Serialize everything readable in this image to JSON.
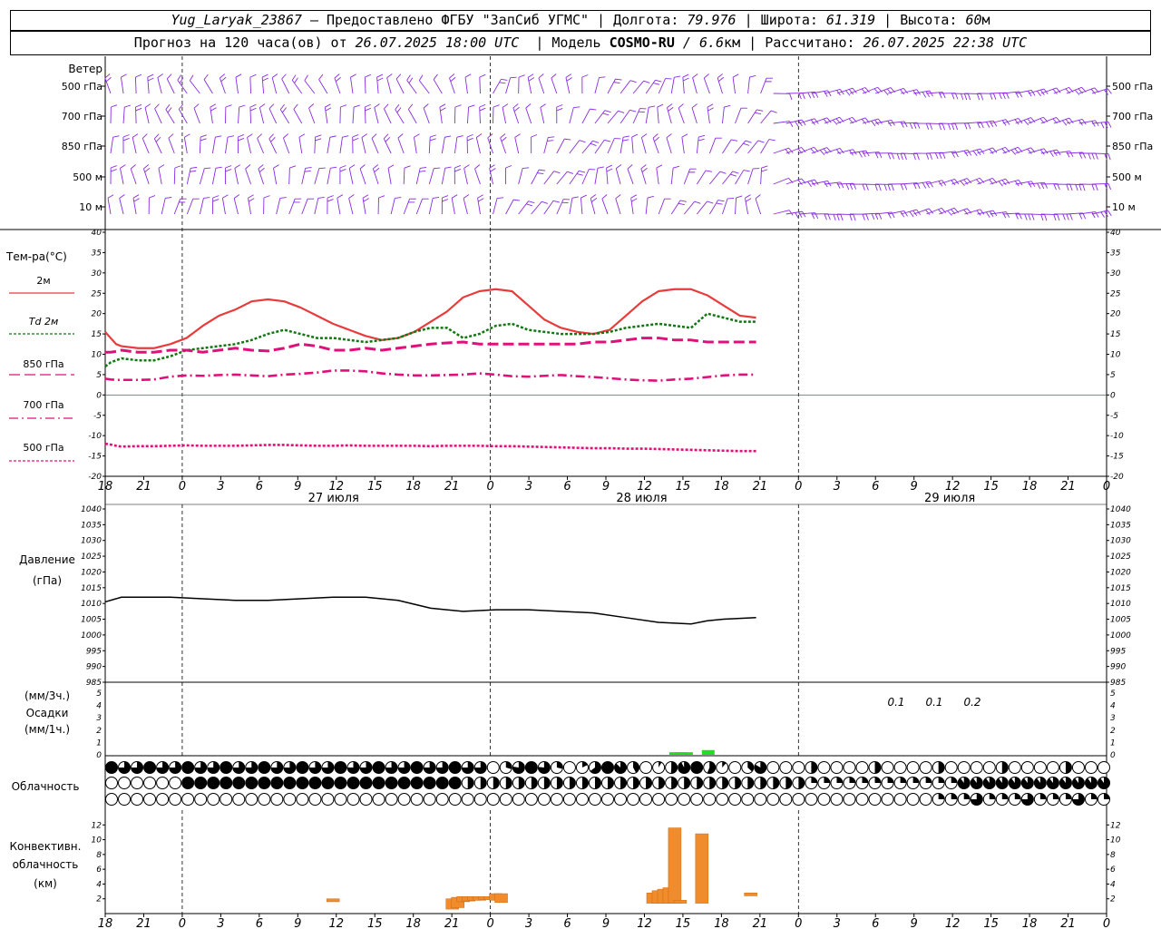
{
  "header": {
    "station": "Yug_Laryak_23867",
    "provided": "— Предоставлено ФГБУ \"ЗапСиб УГМС\"",
    "lon_label": "Долгота:",
    "lon": "79.976",
    "lat_label": "Широта:",
    "lat": "61.319",
    "alt_label": "Высота:",
    "alt": "60",
    "alt_unit": "м",
    "forecast_label": "Прогноз на 120 часа(ов) от",
    "forecast_from": "26.07.2025 18:00 UTC",
    "model_label": "Модель",
    "model": "COSMO-RU",
    "model_res": "/ 6.6",
    "model_res_unit": "км",
    "computed_label": "Рассчитано:",
    "computed": "26.07.2025 22:38 UTC"
  },
  "time_axis": {
    "ticks": [
      "18",
      "21",
      "0",
      "3",
      "6",
      "9",
      "12",
      "15",
      "18",
      "21",
      "0",
      "3",
      "6",
      "9",
      "12",
      "15",
      "18",
      "21",
      "0",
      "3",
      "6",
      "9",
      "12",
      "15",
      "18",
      "21",
      "0"
    ],
    "day_labels": [
      "27 июля",
      "28 июля",
      "29 июля"
    ]
  },
  "wind_panel": {
    "title": "Ветер",
    "levels": [
      "500 гПа",
      "700 гПа",
      "850 гПа",
      "500 м",
      "10 м"
    ]
  },
  "temp_panel": {
    "title": "Тем-ра(°C)",
    "legend": [
      {
        "label": "2м",
        "color": "#e83c3c",
        "dash": "solid"
      },
      {
        "label": "Td  2м",
        "color": "#117711",
        "dash": "dot"
      },
      {
        "label": "850 гПа",
        "color": "#e0107a",
        "dash": "long"
      },
      {
        "label": "700 гПа",
        "color": "#e0107a",
        "dash": "dashdot"
      },
      {
        "label": "500 гПа",
        "color": "#e0107a",
        "dash": "dot"
      }
    ],
    "ticks": [
      "40",
      "35",
      "30",
      "25",
      "20",
      "15",
      "10",
      "5",
      "0",
      "-5",
      "-10",
      "-15",
      "-20"
    ]
  },
  "pressure_panel": {
    "title": "Давление",
    "unit": "(гПа)",
    "ticks": [
      "1040",
      "1035",
      "1030",
      "1025",
      "1020",
      "1015",
      "1010",
      "1005",
      "1000",
      "995",
      "990",
      "985"
    ]
  },
  "precip_panel": {
    "unit3": "(мм/3ч.)",
    "title": "Осадки",
    "unit1": "(мм/1ч.)",
    "ticks": [
      "5",
      "4",
      "3",
      "2",
      "1",
      "0"
    ],
    "labels": [
      "0.1",
      "0.1",
      "0.2"
    ]
  },
  "cloud_panel": {
    "title": "Облачность"
  },
  "conv_panel": {
    "title1": "Конвективн.",
    "title2": "облачность",
    "unit": "(км)",
    "ticks": [
      "12",
      "10",
      "8",
      "6",
      "4",
      "2"
    ]
  },
  "chart_data": [
    {
      "type": "line",
      "title": "Тем-ра(°C)",
      "x_hours": [
        0,
        1,
        2,
        3,
        6,
        9,
        12,
        15,
        18,
        21,
        24,
        27,
        30,
        33,
        36,
        39,
        42,
        45,
        48,
        51,
        54,
        57,
        60,
        63,
        66,
        69,
        72,
        75,
        78,
        81,
        84,
        87,
        90,
        93,
        96,
        99,
        102,
        105,
        108,
        111,
        114,
        117,
        120
      ],
      "ylim": [
        -20,
        40
      ],
      "series": [
        {
          "name": "2м",
          "color": "#e83c3c",
          "values": [
            15.5,
            14,
            12.5,
            12,
            11.5,
            11.5,
            12.5,
            14,
            17,
            19.5,
            21,
            23,
            23.5,
            23,
            21.5,
            19.5,
            17.5,
            16,
            14.5,
            13.5,
            14,
            15.5,
            18,
            20.5,
            24,
            25.5,
            26,
            25.5,
            22,
            18.5,
            16.5,
            15.5,
            15,
            16,
            19.5,
            23,
            25.5,
            26,
            26,
            24.5,
            22,
            19.5,
            19
          ]
        },
        {
          "name": "Td  2м",
          "color": "#117711",
          "values": [
            7,
            8,
            8.5,
            9,
            8.5,
            8.5,
            9.5,
            11,
            11.5,
            12,
            12.5,
            13.5,
            15,
            16,
            15,
            14,
            14,
            13.5,
            13,
            13.5,
            14,
            15.5,
            16.5,
            16.5,
            14,
            15,
            17,
            17.5,
            16,
            15.5,
            15,
            15,
            15,
            15.5,
            16.5,
            17,
            17.5,
            17,
            16.5,
            20,
            19,
            18,
            18
          ]
        },
        {
          "name": "850 гПа",
          "color": "#e0107a",
          "values": [
            10.5,
            10.5,
            10.7,
            11,
            10.5,
            10.5,
            11,
            11,
            10.5,
            11,
            11.5,
            11,
            10.8,
            11.5,
            12.5,
            12,
            11,
            11,
            11.5,
            11,
            11.5,
            12,
            12.5,
            12.8,
            13,
            12.5,
            12.5,
            12.5,
            12.5,
            12.5,
            12.5,
            12.5,
            13,
            13,
            13.5,
            14,
            14,
            13.5,
            13.5,
            13,
            13,
            13,
            13
          ]
        },
        {
          "name": "700 гПа",
          "color": "#e0107a",
          "values": [
            4,
            3.8,
            3.7,
            3.7,
            3.7,
            3.8,
            4.5,
            4.8,
            4.7,
            4.9,
            5,
            4.8,
            4.6,
            5,
            5.2,
            5.5,
            6,
            6,
            5.8,
            5.3,
            5,
            4.8,
            4.8,
            4.9,
            5,
            5.3,
            5,
            4.6,
            4.5,
            4.7,
            4.9,
            4.6,
            4.4,
            4.1,
            3.8,
            3.6,
            3.5,
            3.8,
            4,
            4.4,
            4.8,
            5,
            5
          ]
        },
        {
          "name": "500 гПа",
          "color": "#e0107a",
          "values": [
            -12,
            -12.2,
            -12.5,
            -12.7,
            -12.6,
            -12.6,
            -12.5,
            -12.4,
            -12.5,
            -12.5,
            -12.5,
            -12.4,
            -12.3,
            -12.3,
            -12.4,
            -12.5,
            -12.5,
            -12.4,
            -12.5,
            -12.5,
            -12.5,
            -12.5,
            -12.6,
            -12.5,
            -12.5,
            -12.5,
            -12.6,
            -12.6,
            -12.7,
            -12.8,
            -12.9,
            -13,
            -13.1,
            -13.1,
            -13.2,
            -13.2,
            -13.3,
            -13.4,
            -13.5,
            -13.6,
            -13.7,
            -13.8,
            -13.8
          ]
        }
      ]
    },
    {
      "type": "line",
      "title": "Давление",
      "ylabel": "(гПа)",
      "x_hours": [
        0,
        3,
        6,
        9,
        12,
        18,
        24,
        30,
        36,
        42,
        48,
        54,
        60,
        66,
        72,
        78,
        84,
        90,
        96,
        102,
        108,
        111,
        114,
        120
      ],
      "ylim": [
        985,
        1040
      ],
      "series": [
        {
          "name": "",
          "color": "#000000",
          "values": [
            1010.5,
            1012,
            1012,
            1012,
            1012,
            1011.5,
            1011,
            1011,
            1011.5,
            1012,
            1012,
            1011,
            1008.5,
            1007.5,
            1008,
            1008,
            1007.5,
            1007,
            1005.5,
            1004,
            1003.5,
            1004.5,
            1005,
            1005.5
          ]
        }
      ]
    },
    {
      "type": "bar",
      "title": "Осадки",
      "ylabel": "(мм/1ч.)",
      "x_hours": [
        105,
        106,
        107,
        111
      ],
      "ylim": [
        0,
        5
      ],
      "values": [
        0.1,
        0.1,
        0.1,
        0.2
      ],
      "labels": [
        "0.1",
        "0.1",
        "0.2"
      ]
    },
    {
      "type": "bar",
      "title": "Конвективн. облачность",
      "ylabel": "(км)",
      "ylim": [
        0,
        14
      ],
      "bars": [
        {
          "h": 42,
          "bottom": 1.6,
          "top": 2.0
        },
        {
          "h": 64,
          "bottom": 0.6,
          "top": 2.0
        },
        {
          "h": 65,
          "bottom": 0.8,
          "top": 2.2
        },
        {
          "h": 66,
          "bottom": 1.6,
          "top": 2.3
        },
        {
          "h": 67,
          "bottom": 1.7,
          "top": 2.3
        },
        {
          "h": 68,
          "bottom": 1.8,
          "top": 2.3
        },
        {
          "h": 69,
          "bottom": 1.8,
          "top": 2.3
        },
        {
          "h": 70,
          "bottom": 1.9,
          "top": 2.3
        },
        {
          "h": 71,
          "bottom": 1.9,
          "top": 2.3
        },
        {
          "h": 72,
          "bottom": 1.8,
          "top": 2.7
        },
        {
          "h": 73,
          "bottom": 1.5,
          "top": 2.7
        },
        {
          "h": 101,
          "bottom": 1.4,
          "top": 2.8
        },
        {
          "h": 102,
          "bottom": 1.4,
          "top": 3.1
        },
        {
          "h": 103,
          "bottom": 1.4,
          "top": 3.3
        },
        {
          "h": 104,
          "bottom": 1.4,
          "top": 3.5
        },
        {
          "h": 105,
          "bottom": 1.4,
          "top": 11.6
        },
        {
          "h": 106,
          "bottom": 1.4,
          "top": 1.8
        },
        {
          "h": 110,
          "bottom": 1.4,
          "top": 10.8
        },
        {
          "h": 119,
          "bottom": 2.4,
          "top": 2.8
        }
      ]
    }
  ]
}
